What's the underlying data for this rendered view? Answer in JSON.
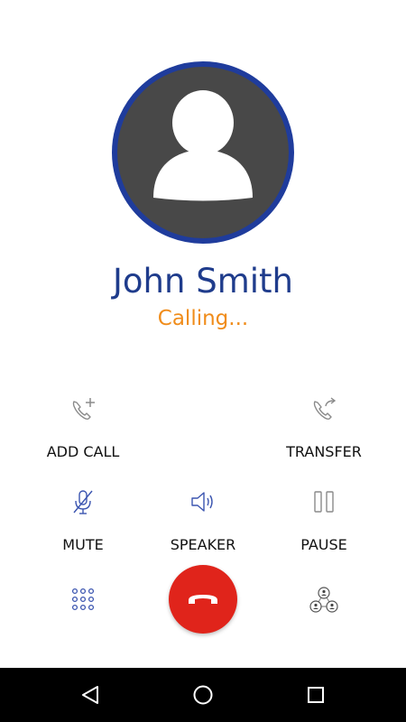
{
  "contact": {
    "name": "John Smith",
    "status": "Calling..."
  },
  "actions": {
    "add_call": "ADD CALL",
    "transfer": "TRANSFER",
    "mute": "MUTE",
    "speaker": "SPEAKER",
    "pause": "PAUSE"
  },
  "icons": {
    "add_call": "phone-plus-icon",
    "transfer": "phone-forward-icon",
    "mute": "mic-off-icon",
    "speaker": "speaker-icon",
    "pause": "pause-icon",
    "dialpad": "dialpad-icon",
    "end_call": "hangup-icon",
    "conference": "conference-icon",
    "nav_back": "back-triangle-icon",
    "nav_home": "home-circle-icon",
    "nav_recents": "recents-square-icon"
  },
  "colors": {
    "accent_blue": "#1f3c9c",
    "status_orange": "#f08c1a",
    "end_call_red": "#e0241b",
    "icon_gray": "#8a8a8a"
  }
}
